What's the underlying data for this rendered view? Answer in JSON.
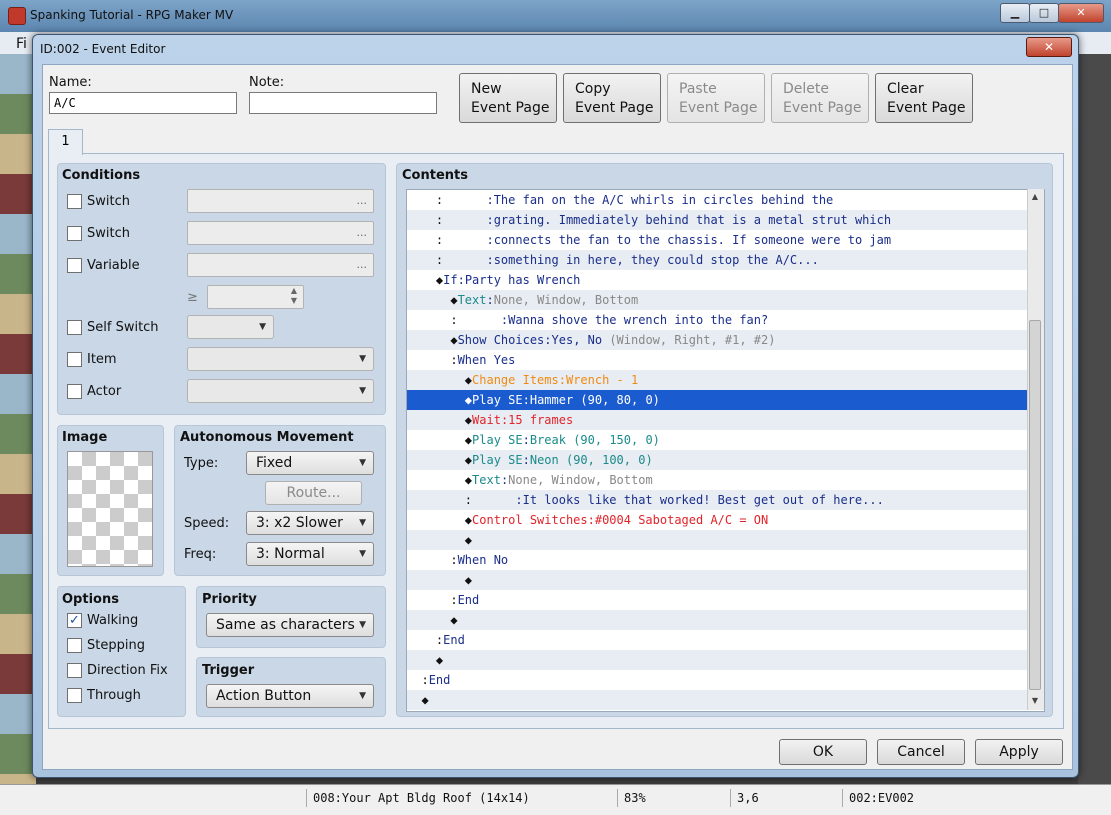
{
  "main_window": {
    "title": "Spanking Tutorial - RPG Maker MV",
    "menu_first": "Fi",
    "status": [
      "008:Your Apt Bldg Roof (14x14)",
      "83%",
      "3,6",
      "002:EV002"
    ]
  },
  "dialog": {
    "title": "ID:002 - Event Editor",
    "close_glyph": "✕",
    "name_label": "Name:",
    "name_value": "A/C",
    "note_label": "Note:",
    "note_value": "",
    "buttons": {
      "new": [
        "New",
        "Event Page"
      ],
      "copy": [
        "Copy",
        "Event Page"
      ],
      "paste": [
        "Paste",
        "Event Page"
      ],
      "delete": [
        "Delete",
        "Event Page"
      ],
      "clear": [
        "Clear",
        "Event Page"
      ]
    },
    "page_tab": "1",
    "conditions": {
      "title": "Conditions",
      "switch1": "Switch",
      "switch2": "Switch",
      "variable": "Variable",
      "ge": "≥",
      "self_switch": "Self Switch",
      "item": "Item",
      "actor": "Actor",
      "ellipsis": "..."
    },
    "image": {
      "title": "Image"
    },
    "movement": {
      "title": "Autonomous Movement",
      "type_label": "Type:",
      "type_value": "Fixed",
      "route": "Route...",
      "speed_label": "Speed:",
      "speed_value": "3: x2 Slower",
      "freq_label": "Freq:",
      "freq_value": "3: Normal"
    },
    "options": {
      "title": "Options",
      "walking": "Walking",
      "walking_checked": true,
      "stepping": "Stepping",
      "direction_fix": "Direction Fix",
      "through": "Through",
      "check_glyph": "✓"
    },
    "priority": {
      "title": "Priority",
      "value": "Same as characters"
    },
    "trigger": {
      "title": "Trigger",
      "value": "Action Button"
    },
    "contents_title": "Contents",
    "ok": "OK",
    "cancel": "Cancel",
    "apply": "Apply"
  },
  "contents_rows": [
    [
      "    :      ",
      ":The fan on the A/C whirls in circles behind the"
    ],
    [
      "    :      ",
      ":grating. Immediately behind that is a metal strut which"
    ],
    [
      "    :      ",
      ":connects the fan to the chassis. If someone were to jam"
    ],
    [
      "    :      ",
      ":something in here, they could stop the A/C..."
    ],
    [
      "    ◆",
      "If",
      ":",
      "Party has Wrench"
    ],
    [
      "      ◆",
      "Text",
      ":",
      "None, Window, Bottom"
    ],
    [
      "      :      ",
      ":Wanna shove the wrench into the fan?"
    ],
    [
      "      ◆",
      "Show Choices",
      ":",
      "Yes, No",
      " (Window, Right, #1, #2)"
    ],
    [
      "      :",
      "When Yes"
    ],
    [
      "        ◆",
      "Change Items",
      ":",
      "Wrench - 1"
    ],
    [
      "        ◆",
      "Play SE",
      ":",
      "Hammer (90, 80, 0)"
    ],
    [
      "        ◆",
      "Wait",
      ":",
      "15 frames"
    ],
    [
      "        ◆",
      "Play SE",
      ":",
      "Break (90, 150, 0)"
    ],
    [
      "        ◆",
      "Play SE",
      ":",
      "Neon (90, 100, 0)"
    ],
    [
      "        ◆",
      "Text",
      ":",
      "None, Window, Bottom"
    ],
    [
      "        :      ",
      ":It looks like that worked! Best get out of here..."
    ],
    [
      "        ◆",
      "Control Switches",
      ":",
      "#0004 Sabotaged A/C = ON"
    ],
    [
      "        ◆"
    ],
    [
      "      :",
      "When No"
    ],
    [
      "        ◆"
    ],
    [
      "      :",
      "End"
    ],
    [
      "      ◆"
    ],
    [
      "    :",
      "End"
    ],
    [
      "    ◆"
    ],
    [
      "  :",
      "End"
    ],
    [
      "  ◆"
    ]
  ],
  "colors": {
    "selection": "#1b5bd0",
    "command_teal": "#1b8a8a",
    "command_orange": "#f08a12",
    "command_red": "#e0242a",
    "text_navy": "#1a2e8a"
  }
}
